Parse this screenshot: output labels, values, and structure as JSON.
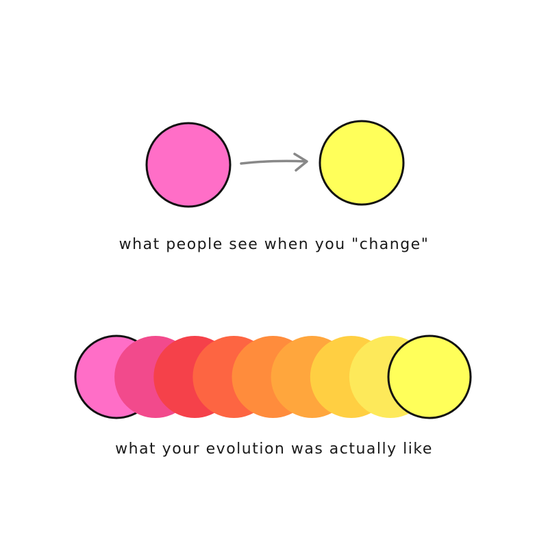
{
  "top_panel": {
    "caption": "what people see when you \"change\"",
    "start_color": "#ff6ec7",
    "end_color": "#ffff5a",
    "arrow_color": "#888888",
    "outline_color": "#111111"
  },
  "bottom_panel": {
    "caption": "what your evolution was actually like",
    "gradient_colors": [
      "#ff6ec7",
      "#f24a8c",
      "#f5414a",
      "#fd6542",
      "#ff8c3c",
      "#ffa63d",
      "#ffcf42",
      "#fde95a",
      "#ffff5a"
    ],
    "outline_color": "#111111"
  }
}
